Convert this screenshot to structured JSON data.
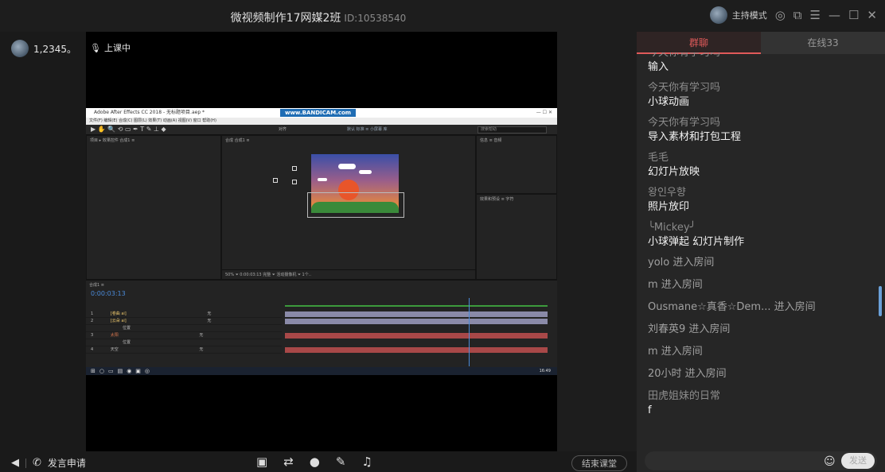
{
  "window": {
    "title": "微视频制作17网媒2班",
    "room_id": "ID:10538540",
    "host_mode_label": "主持模式",
    "controls": [
      "settings-icon",
      "external-icon",
      "menu-icon",
      "minimize-icon",
      "maximize-icon",
      "close-icon"
    ]
  },
  "left_panel": {
    "user_name": "1,2345。",
    "status": "上课中"
  },
  "shared_screen": {
    "app_title": "Adobe After Effects CC 2018 - 无标题项目.aep *",
    "watermark": "www.BANDICAM.com",
    "menu": "文件(F)  编辑(E)  合成(C)  图层(L)  效果(T)  动画(A)  视图(V)  窗口  帮助(H)",
    "snap_label": "对齐",
    "workspace": "默认    标准  ≡    小屏幕    库",
    "search_placeholder": "搜索帮助",
    "project_tab": "项目",
    "effects_tab": "效果控件 合成1 ≡",
    "comp_tab": "合成 合成1 ≡",
    "info_tab": "信息 ≡  音频",
    "preset_tab": "效果和预设 ≡  字符",
    "comp_toolbar": "50%  ⏷  0:00:03:13  完整  ⏷  活动摄像机  ⏷  1个..",
    "timeline_tab": "合成1 ≡",
    "timecode": "0:00:03:13",
    "layers": [
      {
        "num": "1",
        "name": "[卷曲 ai]",
        "mode": "无"
      },
      {
        "num": "2",
        "name": "[云朵 ai]",
        "mode": "无"
      },
      {
        "num": "",
        "name": "位置",
        "mode": ""
      },
      {
        "num": "3",
        "name": "太阳",
        "mode": "无"
      },
      {
        "num": "",
        "name": "位置",
        "mode": ""
      },
      {
        "num": "4",
        "name": "天空",
        "mode": "无"
      }
    ],
    "taskbar_time": "16:49"
  },
  "bottom_bar": {
    "speak_request": "发言申请",
    "end_class": "结束课堂"
  },
  "chat": {
    "tabs": [
      {
        "label": "群聊",
        "active": true
      },
      {
        "label": "在线33",
        "active": false
      }
    ],
    "messages": [
      {
        "user": "今天你有学习吗",
        "text": "输入"
      },
      {
        "user": "今天你有学习吗",
        "text": "小球动画"
      },
      {
        "user": "今天你有学习吗",
        "text": "导入素材和打包工程"
      },
      {
        "user": "毛毛",
        "text": "幻灯片放映"
      },
      {
        "user": "왕인우향",
        "text": "照片放印"
      },
      {
        "user": "╰Mickey╯",
        "text": "小球弹起  幻灯片制作"
      }
    ],
    "system": [
      "yolo 进入房间",
      "m 进入房间",
      "Ousmane☆真香☆Dem... 进入房间",
      "刘春英9 进入房间",
      "m 进入房间",
      "20小时 进入房间"
    ],
    "last": {
      "user": "田虎姐妹的日常",
      "text": "f"
    },
    "send_label": "发送"
  },
  "colors": {
    "accent": "#e05a5a",
    "timecode": "#4a8ad8"
  }
}
